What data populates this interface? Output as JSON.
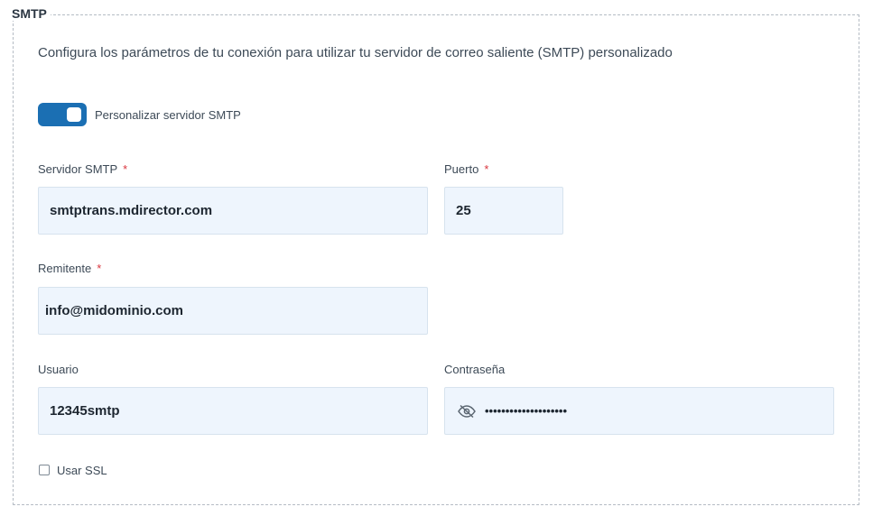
{
  "section": {
    "legend": "SMTP",
    "description": "Configura los parámetros de tu conexión para utilizar tu servidor de correo saliente (SMTP) personalizado"
  },
  "toggle": {
    "label": "Personalizar servidor SMTP",
    "state": "on",
    "color": "#1b6fb3"
  },
  "required_mark": "*",
  "fields": {
    "servidor": {
      "label": "Servidor SMTP",
      "value": "smtptrans.mdirector.com",
      "required": true
    },
    "puerto": {
      "label": "Puerto",
      "value": "25",
      "required": true
    },
    "remitente": {
      "label": "Remitente",
      "value": "info@midominio.com",
      "required": true
    },
    "usuario": {
      "label": "Usuario",
      "value": "12345smtp",
      "required": false
    },
    "contrasena": {
      "label": "Contraseña",
      "value": "••••••••••••••••••••",
      "required": false,
      "icon": "eye-hidden-icon"
    }
  },
  "ssl": {
    "label": "Usar SSL",
    "checked": false
  }
}
